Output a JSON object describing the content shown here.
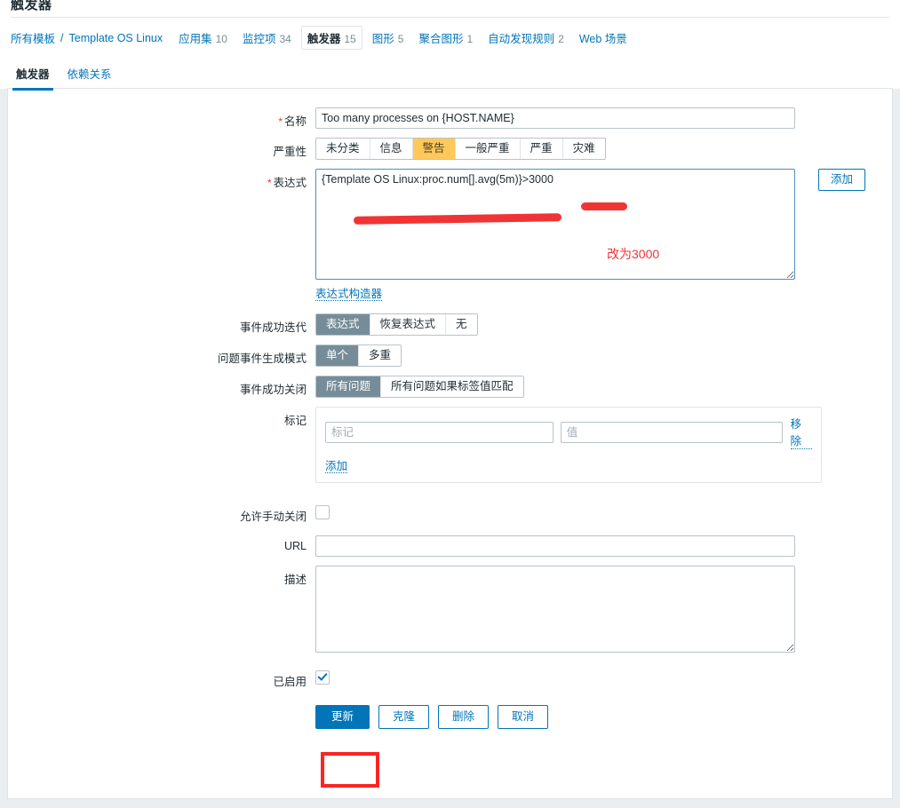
{
  "page": {
    "title": "触发器"
  },
  "breadcrumb": {
    "all_templates": "所有模板",
    "separator": "/",
    "template_name": "Template OS Linux",
    "items": [
      {
        "label": "应用集",
        "count": "10",
        "selected": false
      },
      {
        "label": "监控项",
        "count": "34",
        "selected": false
      },
      {
        "label": "触发器",
        "count": "15",
        "selected": true
      },
      {
        "label": "图形",
        "count": "5",
        "selected": false
      },
      {
        "label": "聚合图形",
        "count": "1",
        "selected": false
      },
      {
        "label": "自动发现规则",
        "count": "2",
        "selected": false
      },
      {
        "label": "Web 场景",
        "count": "",
        "selected": false
      }
    ]
  },
  "tabs": [
    {
      "label": "触发器",
      "active": true
    },
    {
      "label": "依赖关系",
      "active": false
    }
  ],
  "form": {
    "name": {
      "label": "名称",
      "required": true,
      "value": "Too many processes on {HOST.NAME}"
    },
    "severity": {
      "label": "严重性",
      "options": [
        "未分类",
        "信息",
        "警告",
        "一般严重",
        "严重",
        "灾难"
      ],
      "selected": "警告"
    },
    "expression": {
      "label": "表达式",
      "required": true,
      "value": "{Template OS Linux:proc.num[].avg(5m)}>3000",
      "add_button": "添加",
      "constructor_link": "表达式构造器"
    },
    "event_generation": {
      "label": "事件成功迭代",
      "options": [
        "表达式",
        "恢复表达式",
        "无"
      ],
      "selected": "表达式"
    },
    "problem_event_mode": {
      "label": "问题事件生成模式",
      "options": [
        "单个",
        "多重"
      ],
      "selected": "单个"
    },
    "close_event": {
      "label": "事件成功关闭",
      "options": [
        "所有问题",
        "所有问题如果标签值匹配"
      ],
      "selected": "所有问题"
    },
    "tags": {
      "label": "标记",
      "rows": [
        {
          "key_placeholder": "标记",
          "key_value": "",
          "value_placeholder": "值",
          "value_value": "",
          "remove_label": "移除"
        }
      ],
      "add_label": "添加"
    },
    "manual_close": {
      "label": "允许手动关闭",
      "checked": false
    },
    "url": {
      "label": "URL",
      "value": "",
      "placeholder": ""
    },
    "description": {
      "label": "描述",
      "value": "",
      "placeholder": ""
    },
    "enabled": {
      "label": "已启用",
      "checked": true
    }
  },
  "footer": {
    "update": "更新",
    "clone": "克隆",
    "delete": "删除",
    "cancel": "取消"
  },
  "annotations": {
    "note_text": "改为3000",
    "color": "#f03434",
    "highlight_color": "#fb2525"
  }
}
